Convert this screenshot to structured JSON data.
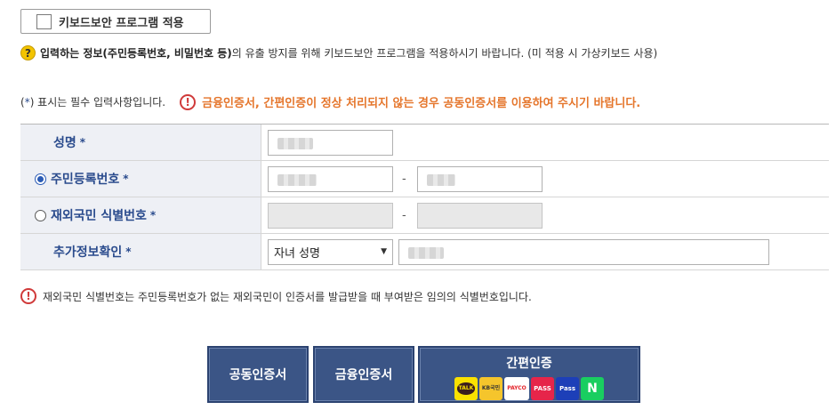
{
  "keyboard_security": {
    "label": "키보드보안 프로그램 적용",
    "checked": false
  },
  "notice": {
    "icon": "question-icon",
    "bold_text": "입력하는 정보(주민등록번호, 비밀번호 등)",
    "text": "의 유출 방지를 위해 키보드보안 프로그램을 적용하시기 바랍니다. (미 적용 시 가상키보드 사용)"
  },
  "required_note": {
    "prefix": "(",
    "star": "*",
    "suffix": ") 표시는 필수 입력사항입니다."
  },
  "warning": {
    "icon": "exclamation-icon",
    "text": "금융인증서, 간편인증이 정상 처리되지 않는 경우 공동인증서를 이용하여 주시기 바랍니다."
  },
  "form": {
    "star": "*",
    "name_label": "성명",
    "rrn_label": "주민등록번호",
    "rrn_selected": true,
    "foreign_label": "재외국민 식별번호",
    "foreign_selected": false,
    "dash": "-",
    "extra_label": "추가정보확인",
    "extra_select_value": "자녀 성명"
  },
  "foot_note": {
    "icon": "exclamation-icon",
    "text": "재외국민 식별번호는 주민등록번호가 없는 재외국민이 인증서를 발급받을 때 부여받은 임의의 식별번호입니다."
  },
  "buttons": {
    "joint_cert": "공동인증서",
    "financial_cert": "금융인증서",
    "simple_auth": "간편인증",
    "simple_logos": {
      "kakao": "TALK",
      "kb": "KB국민",
      "payco": "PAYCO",
      "pass": "PASS",
      "samsung_pass": "Pass",
      "naver": "N"
    }
  },
  "colors": {
    "accent": "#2a4b8d",
    "warning": "#e5762c",
    "button": "#3b5586"
  }
}
